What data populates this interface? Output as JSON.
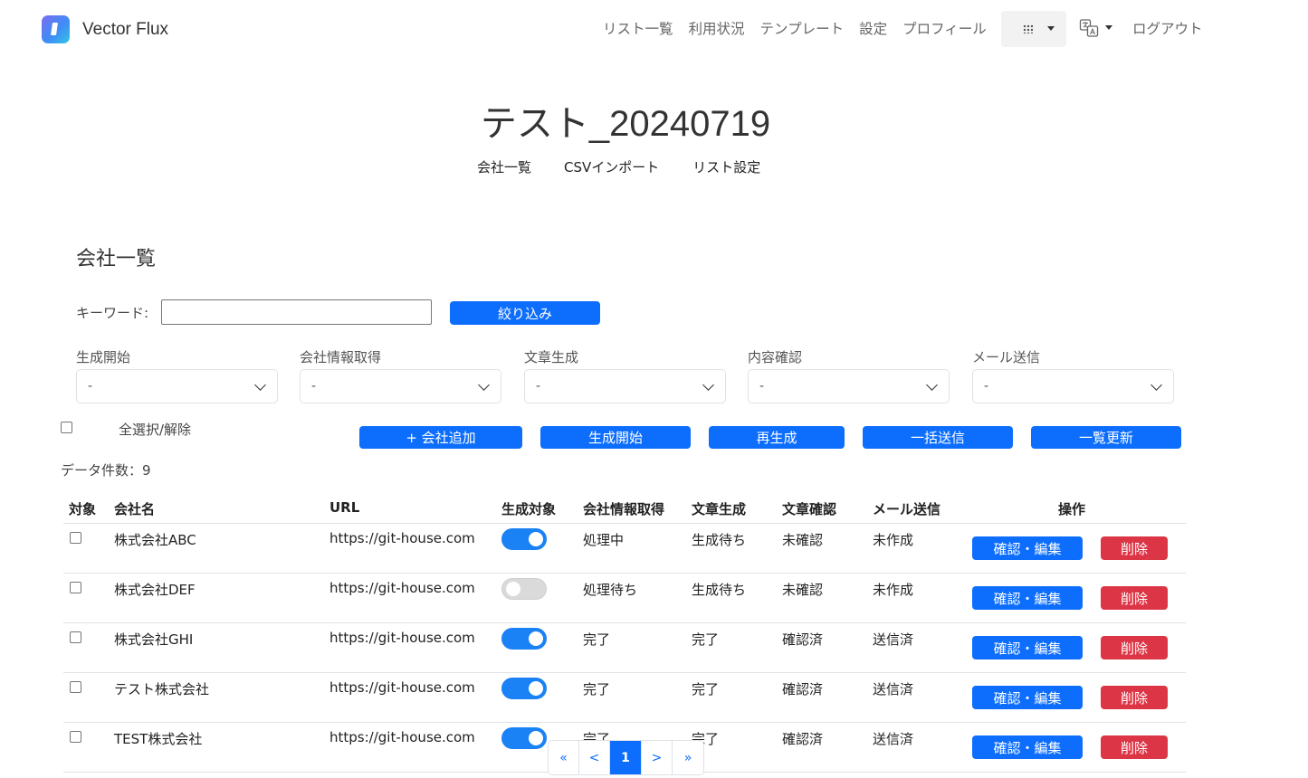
{
  "app": {
    "name": "Vector Flux"
  },
  "nav": {
    "links": [
      "リスト一覧",
      "利用状況",
      "テンプレート",
      "設定",
      "プロフィール"
    ],
    "logout": "ログアウト"
  },
  "page": {
    "title": "テスト_20240719",
    "subnav": [
      "会社一覧",
      "CSVインポート",
      "リスト設定"
    ],
    "section_title": "会社一覧"
  },
  "search": {
    "label": "キーワード:",
    "value": "",
    "button": "絞り込み"
  },
  "filters": [
    {
      "label": "生成開始",
      "value": "-"
    },
    {
      "label": "会社情報取得",
      "value": "-"
    },
    {
      "label": "文章生成",
      "value": "-"
    },
    {
      "label": "内容確認",
      "value": "-"
    },
    {
      "label": "メール送信",
      "value": "-"
    }
  ],
  "select_all_label": "全選択/解除",
  "actions": {
    "add_company": "+ 会社追加",
    "start_generate": "生成開始",
    "regenerate": "再生成",
    "bulk_send": "一括送信",
    "refresh_list": "一覧更新"
  },
  "data_count": "データ件数：9",
  "table": {
    "headers": [
      "対象",
      "会社名",
      "URL",
      "生成対象",
      "会社情報取得",
      "文章生成",
      "文章確認",
      "メール送信",
      "操作"
    ],
    "rows": [
      {
        "name": "株式会社ABC",
        "url": "https://git-house.com",
        "generate": true,
        "info": "処理中",
        "text": "生成待ち",
        "check": "未確認",
        "mail": "未作成"
      },
      {
        "name": "株式会社DEF",
        "url": "https://git-house.com",
        "generate": false,
        "info": "処理待ち",
        "text": "生成待ち",
        "check": "未確認",
        "mail": "未作成"
      },
      {
        "name": "株式会社GHI",
        "url": "https://git-house.com",
        "generate": true,
        "info": "完了",
        "text": "完了",
        "check": "確認済",
        "mail": "送信済"
      },
      {
        "name": "テスト株式会社",
        "url": "https://git-house.com",
        "generate": true,
        "info": "完了",
        "text": "完了",
        "check": "確認済",
        "mail": "送信済"
      },
      {
        "name": "TEST株式会社",
        "url": "https://git-house.com",
        "generate": true,
        "info": "完了",
        "text": "完了",
        "check": "確認済",
        "mail": "送信済"
      }
    ],
    "edit_label": "確認・編集",
    "delete_label": "削除"
  },
  "pagination": {
    "first": "«",
    "prev": "<",
    "current": "1",
    "next": ">",
    "last": "»"
  },
  "colors": {
    "primary": "#0d6efd",
    "danger": "#dc3545",
    "toggle_on": "#1a82f5",
    "toggle_off": "#dadada"
  }
}
